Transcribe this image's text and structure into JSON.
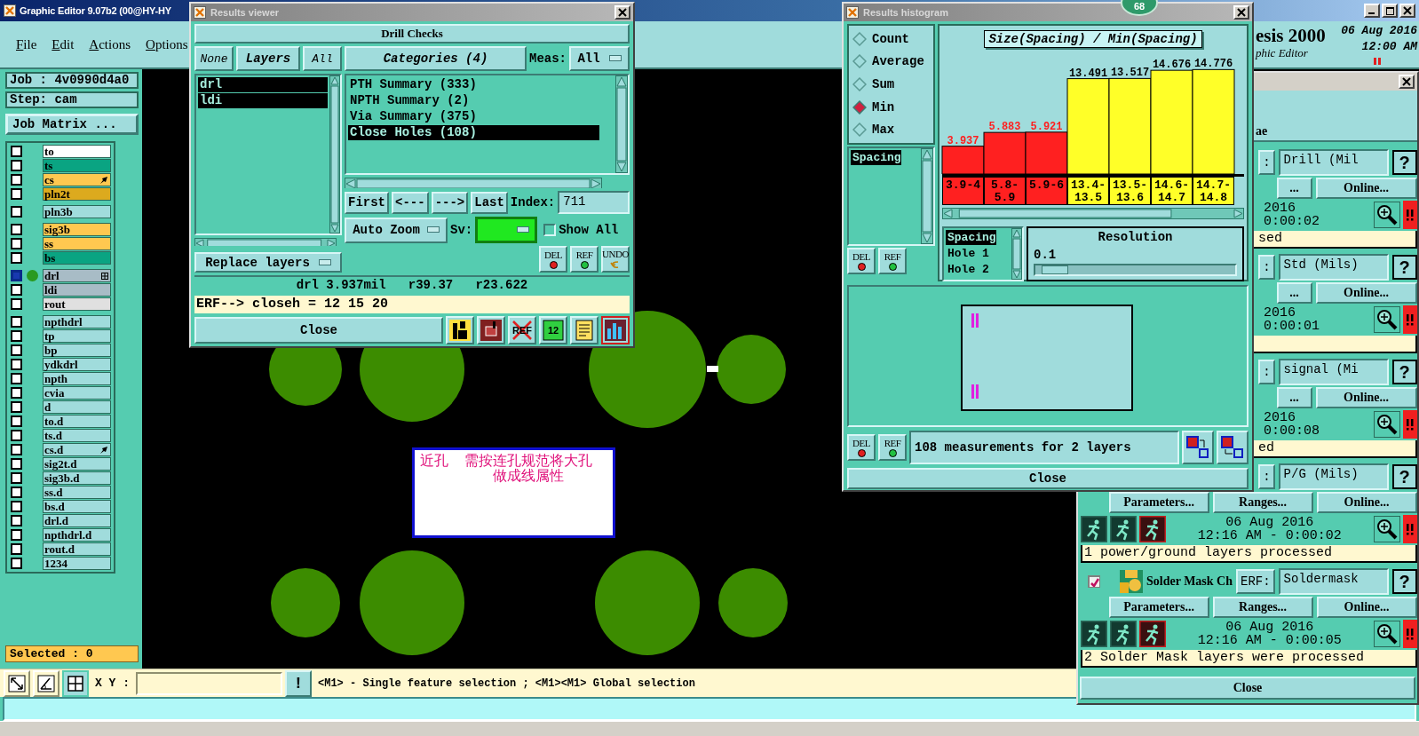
{
  "main_window": {
    "title": "Graphic Editor 9.07b2 (00@HY-HY",
    "menu": [
      "File",
      "Edit",
      "Actions",
      "Options"
    ],
    "brand": {
      "name": "esis 2000",
      "date": "06 Aug 2016",
      "time": "12:00 AM",
      "subtitle": "phic Editor"
    },
    "job": "Job : 4v0990d4a0",
    "step": "Step: cam",
    "job_matrix_button": "Job Matrix ...",
    "layer_groups": [
      [
        {
          "name": "to",
          "color": "#ffffff",
          "selected": false
        },
        {
          "name": "ts",
          "color": "#0aa482",
          "selected": false
        },
        {
          "name": "cs",
          "color": "#ffc850",
          "selected": false,
          "has_pointer": true
        },
        {
          "name": "pln2t",
          "color": "#dcaa1e",
          "selected": false
        }
      ],
      [
        {
          "name": "pln3b",
          "color": "#a0dcdc",
          "selected": false
        }
      ],
      [
        {
          "name": "sig3b",
          "color": "#ffc850",
          "selected": false
        },
        {
          "name": "ss",
          "color": "#ffc850",
          "selected": false
        },
        {
          "name": "bs",
          "color": "#0aa482",
          "selected": false
        }
      ],
      [
        {
          "name": "drl",
          "color": "#a8bcc6",
          "selected": true,
          "has_grid_marker": true
        },
        {
          "name": "ldi",
          "color": "#a8bcc6",
          "selected": false
        },
        {
          "name": "rout",
          "color": "#e0e0e0",
          "selected": false
        }
      ],
      [
        {
          "name": "npthdrl",
          "color": "#a0dcdc",
          "selected": false
        },
        {
          "name": "tp",
          "color": "#a0dcdc",
          "selected": false
        },
        {
          "name": "bp",
          "color": "#a0dcdc",
          "selected": false
        },
        {
          "name": "ydkdrl",
          "color": "#a0dcdc",
          "selected": false
        },
        {
          "name": "npth",
          "color": "#a0dcdc",
          "selected": false
        },
        {
          "name": "cvia",
          "color": "#a0dcdc",
          "selected": false
        },
        {
          "name": "d",
          "color": "#a0dcdc",
          "selected": false
        },
        {
          "name": "to.d",
          "color": "#a0dcdc",
          "selected": false
        },
        {
          "name": "ts.d",
          "color": "#a0dcdc",
          "selected": false
        },
        {
          "name": "cs.d",
          "color": "#a0dcdc",
          "selected": false,
          "has_pointer": true
        },
        {
          "name": "sig2t.d",
          "color": "#a0dcdc",
          "selected": false
        },
        {
          "name": "sig3b.d",
          "color": "#a0dcdc",
          "selected": false
        },
        {
          "name": "ss.d",
          "color": "#a0dcdc",
          "selected": false
        },
        {
          "name": "bs.d",
          "color": "#a0dcdc",
          "selected": false
        },
        {
          "name": "drl.d",
          "color": "#a0dcdc",
          "selected": false
        },
        {
          "name": "npthdrl.d",
          "color": "#a0dcdc",
          "selected": false
        },
        {
          "name": "rout.d",
          "color": "#a0dcdc",
          "selected": false
        },
        {
          "name": "1234",
          "color": "#a0dcdc",
          "selected": false
        }
      ]
    ],
    "selected_count": "Selected : 0",
    "canvas": {
      "note": {
        "label": "近孔",
        "lines": [
          "需按连孔规范将大孔",
          "做成线属性"
        ]
      }
    },
    "toolbar": {
      "tools": [
        {
          "kind": "arrow",
          "selected": false
        },
        {
          "kind": "angle",
          "selected": false
        },
        {
          "kind": "grid",
          "selected": true
        }
      ],
      "xy_label": "X Y :",
      "alert_button": "!",
      "hint": "<M1> - Single feature selection ; <M1><M1> Global selection"
    }
  },
  "results_viewer": {
    "title": "Results viewer",
    "header": "Drill Checks",
    "layer_tabs": [
      "None",
      "Layers",
      "All"
    ],
    "layers": [
      {
        "name": "drl",
        "selected": true
      },
      {
        "name": "ldi",
        "selected": true
      }
    ],
    "replace_dropdown": "Replace layers",
    "categories_button": "Categories (4)",
    "meas_label": "Meas:",
    "meas_value": "All",
    "categories": [
      {
        "name": "PTH Summary (333)",
        "selected": false
      },
      {
        "name": "NPTH Summary (2)",
        "selected": false
      },
      {
        "name": "Via Summary (375)",
        "selected": false
      },
      {
        "name": "Close Holes (108)",
        "selected": true
      }
    ],
    "nav_buttons": [
      "First",
      "<---",
      "--->",
      "Last"
    ],
    "index_label": "Index:",
    "index_value": "711",
    "zoom_dropdown": "Auto Zoom",
    "sv_label": "Sv:",
    "show_all": {
      "label": "Show All",
      "checked": false
    },
    "tool_buttons": [
      {
        "kind": "del",
        "label": "DEL"
      },
      {
        "kind": "ref",
        "label": "REF"
      },
      {
        "kind": "undo",
        "label": "UNDO"
      }
    ],
    "info": "drl 3.937mil   r39.37   r23.622",
    "erf": "ERF--> closeh = 12 15 20",
    "close": "Close",
    "icon_buttons": [
      {
        "kind": "figure",
        "selected": false
      },
      {
        "kind": "layer",
        "selected": false
      },
      {
        "kind": "no_ref",
        "label": "REF",
        "selected": false
      },
      {
        "kind": "page",
        "label": "12",
        "selected": false
      },
      {
        "kind": "notes",
        "selected": false
      },
      {
        "kind": "chart",
        "selected": true
      }
    ]
  },
  "results_histogram": {
    "title": "Results histogram",
    "stats": [
      {
        "label": "Count",
        "selected": false
      },
      {
        "label": "Average",
        "selected": false
      },
      {
        "label": "Sum",
        "selected": false
      },
      {
        "label": "Min",
        "selected": true
      },
      {
        "label": "Max",
        "selected": false
      }
    ],
    "measure_list": [
      {
        "label": "Spacing",
        "selected": true
      }
    ],
    "tool_buttons": [
      {
        "kind": "del",
        "label": "DEL"
      },
      {
        "kind": "ref",
        "label": "REF"
      }
    ],
    "chart_data": {
      "type": "bar",
      "title": "Size(Spacing) / Min(Spacing)",
      "categories": [
        "3.9-4",
        "5.8-5.9",
        "5.9-6",
        "13.4-13.5",
        "13.5-13.6",
        "14.6-14.7",
        "14.7-14.8"
      ],
      "series": [
        {
          "color": "#ff2020",
          "values": [
            3.937,
            5.883,
            5.921,
            null,
            null,
            null,
            null
          ]
        },
        {
          "color": "#ffff28",
          "values": [
            null,
            null,
            null,
            13.491,
            13.517,
            14.676,
            14.776
          ]
        }
      ],
      "data_labels": true
    },
    "field_list": [
      {
        "label": "Spacing",
        "selected": true
      },
      {
        "label": "Hole 1",
        "selected": false
      },
      {
        "label": "Hole 2",
        "selected": false
      }
    ],
    "resolution": {
      "label": "Resolution",
      "value": "0.1",
      "level": 0.03
    },
    "bottom_tool_buttons": [
      {
        "kind": "del",
        "label": "DEL"
      },
      {
        "kind": "ref",
        "label": "REF"
      }
    ],
    "summary": "108 measurements for 2 layers",
    "close": "Close"
  },
  "checklist_window": {
    "header": "ae",
    "items": [
      {
        "kind": "compact",
        "erf_label": ":",
        "erf_value": "Drill (Mil",
        "help": "?",
        "buttons": [
          "...",
          "Online..."
        ],
        "date": "2016",
        "time": "0:00:02",
        "status": "sed"
      },
      {
        "kind": "compact",
        "erf_label": ":",
        "erf_value": "Std (Mils)",
        "help": "?",
        "buttons": [
          "...",
          "Online..."
        ],
        "date": "2016",
        "time": "0:00:01"
      },
      {
        "kind": "compact",
        "erf_label": ":",
        "erf_value": "signal (Mi",
        "help": "?",
        "buttons": [
          "...",
          "Online..."
        ],
        "date": "2016",
        "time": "0:00:08",
        "status": "ed"
      },
      {
        "kind": "full",
        "erf_label": ":",
        "erf_value": "P/G (Mils)",
        "help": "?",
        "buttons": [
          "Parameters...",
          "Ranges...",
          "Online..."
        ],
        "date": "06 Aug 2016",
        "time": "12:16 AM - 0:00:02",
        "status": "1 power/ground layers processed"
      },
      {
        "kind": "full",
        "checked": true,
        "title": "Solder Mask Ch",
        "erf_label": "ERF:",
        "erf_value": "Soldermask",
        "help": "?",
        "buttons": [
          "Parameters...",
          "Ranges...",
          "Online..."
        ],
        "date": "06 Aug 2016",
        "time": "12:16 AM - 0:00:05",
        "status": "2 Solder Mask layers were processed"
      }
    ],
    "close": "Close"
  },
  "overlay_badge": "68"
}
